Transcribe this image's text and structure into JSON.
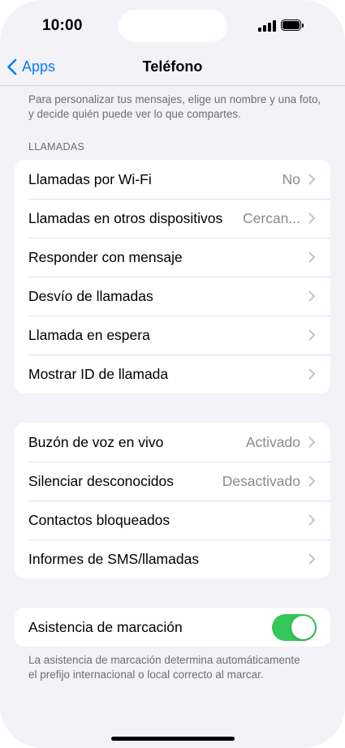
{
  "status_bar": {
    "time": "10:00"
  },
  "nav": {
    "back_label": "Apps",
    "title": "Teléfono"
  },
  "intro_text": "Para personalizar tus mensajes, elige un nombre y una foto, y decide quién puede ver lo que compartes.",
  "section_calls": {
    "header": "LLAMADAS",
    "items": [
      {
        "label": "Llamadas por Wi-Fi",
        "value": "No"
      },
      {
        "label": "Llamadas en otros dispositivos",
        "value": "Cercan..."
      },
      {
        "label": "Responder con mensaje",
        "value": ""
      },
      {
        "label": "Desvío de llamadas",
        "value": ""
      },
      {
        "label": "Llamada en espera",
        "value": ""
      },
      {
        "label": "Mostrar ID de llamada",
        "value": ""
      }
    ]
  },
  "section_voicemail": {
    "items": [
      {
        "label": "Buzón de voz en vivo",
        "value": "Activado"
      },
      {
        "label": "Silenciar desconocidos",
        "value": "Desactivado"
      },
      {
        "label": "Contactos bloqueados",
        "value": ""
      },
      {
        "label": "Informes de SMS/llamadas",
        "value": ""
      }
    ]
  },
  "section_dial": {
    "label": "Asistencia de marcación",
    "toggle_on": true,
    "footer": "La asistencia de marcación determina automáticamente el prefijo internacional o local correcto al marcar."
  },
  "colors": {
    "accent": "#0a7aff",
    "toggle_on": "#34c759",
    "background": "#f2f2f7",
    "secondary_text": "#8a8a8e"
  }
}
